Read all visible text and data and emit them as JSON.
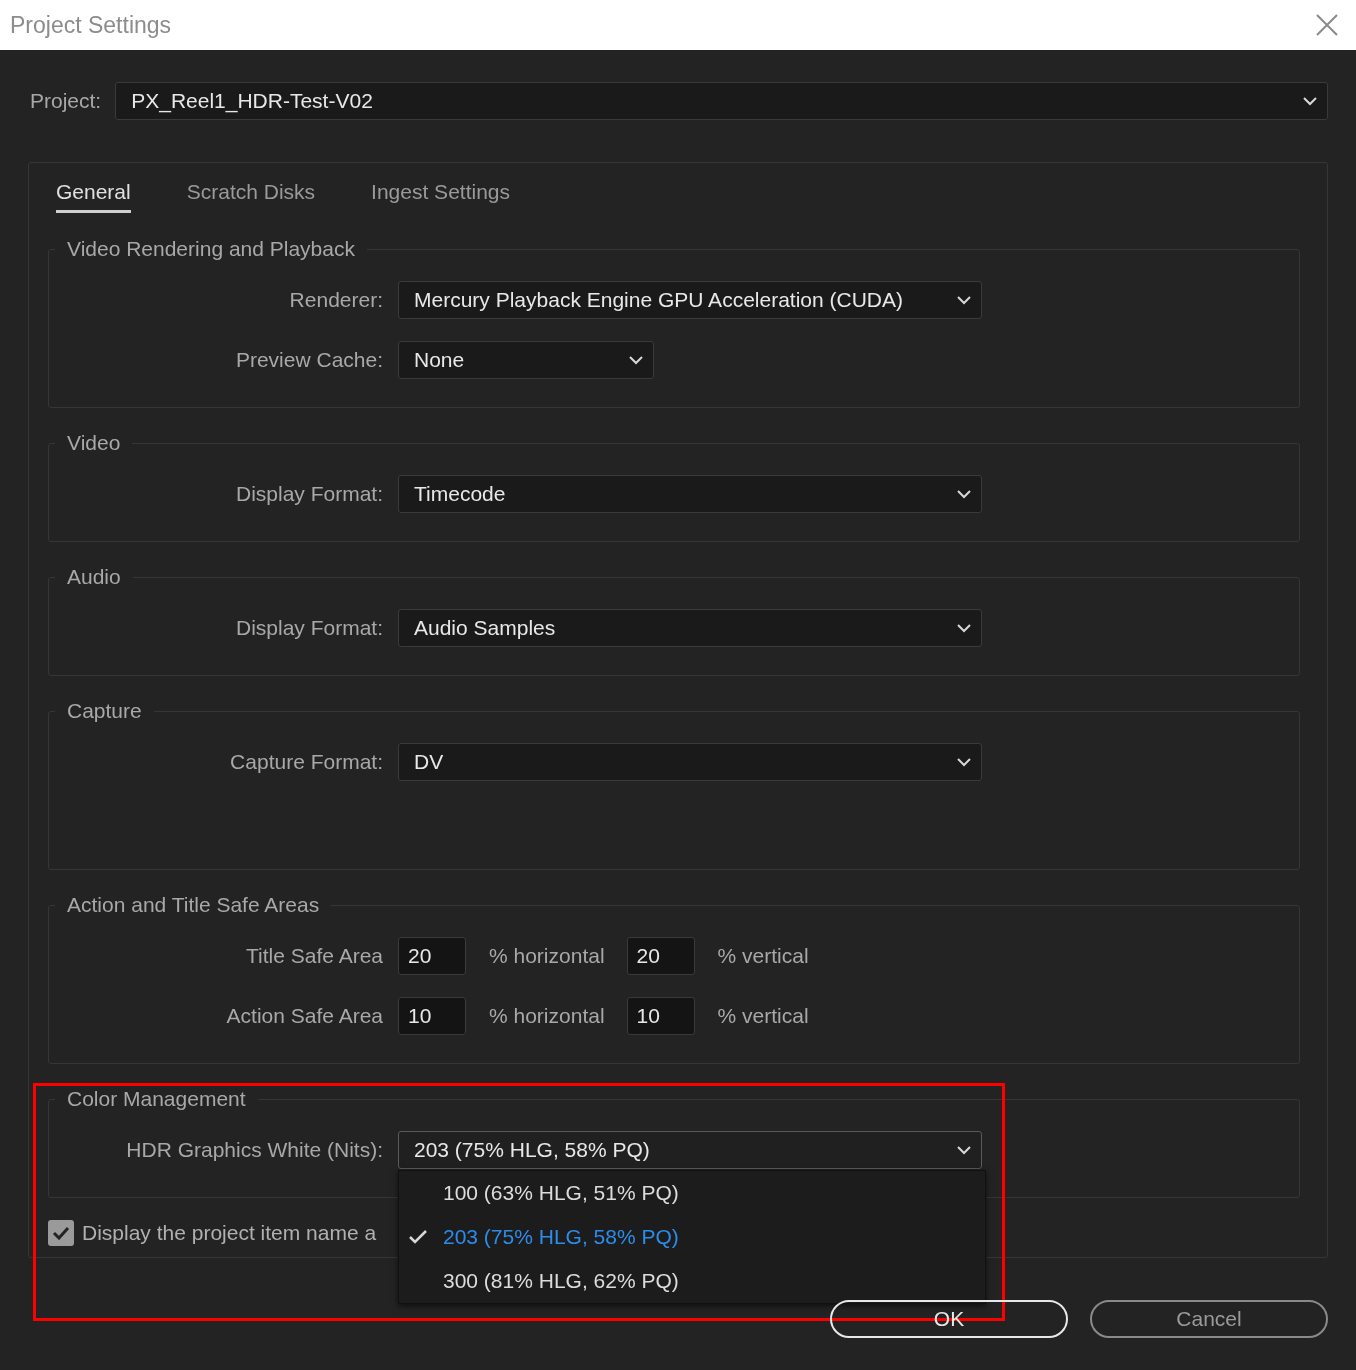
{
  "window": {
    "title": "Project Settings"
  },
  "project": {
    "label": "Project:",
    "value": "PX_Reel1_HDR-Test-V02"
  },
  "tabs": [
    {
      "label": "General",
      "selected": true
    },
    {
      "label": "Scratch Disks",
      "selected": false
    },
    {
      "label": "Ingest Settings",
      "selected": false
    }
  ],
  "sections": [
    {
      "title": "Video Rendering and Playback",
      "rows": [
        {
          "kind": "dropdown",
          "label": "Renderer:",
          "value": "Mercury Playback Engine GPU Acceleration (CUDA)"
        },
        {
          "kind": "dropdown",
          "label": "Preview Cache:",
          "value": "None"
        }
      ]
    },
    {
      "title": "Video",
      "rows": [
        {
          "kind": "dropdown",
          "label": "Display Format:",
          "value": "Timecode"
        }
      ]
    },
    {
      "title": "Audio",
      "rows": [
        {
          "kind": "dropdown",
          "label": "Display Format:",
          "value": "Audio Samples"
        }
      ]
    },
    {
      "title": "Capture",
      "rows": [
        {
          "kind": "dropdown",
          "label": "Capture Format:",
          "value": "DV"
        }
      ]
    },
    {
      "title": "Action and Title Safe Areas",
      "rows": [
        {
          "kind": "safe-area",
          "label": "Title Safe Area",
          "horizontal": "20",
          "horizontal_unit": "% horizontal",
          "vertical": "20",
          "vertical_unit": "% vertical"
        },
        {
          "kind": "safe-area",
          "label": "Action Safe Area",
          "horizontal": "10",
          "horizontal_unit": "% horizontal",
          "vertical": "10",
          "vertical_unit": "% vertical"
        }
      ]
    },
    {
      "title": "Color Management",
      "rows": [
        {
          "kind": "dropdown",
          "label": "HDR Graphics White (Nits):",
          "value": "203 (75% HLG, 58% PQ)",
          "expanded": true,
          "options": [
            {
              "label": "100 (63% HLG, 51% PQ)",
              "selected": false
            },
            {
              "label": "203 (75% HLG, 58% PQ)",
              "selected": true
            },
            {
              "label": "300 (81% HLG, 62% PQ)",
              "selected": false
            }
          ]
        }
      ]
    }
  ],
  "checkbox": {
    "label": "Display the project item name a",
    "checked": true
  },
  "buttons": [
    {
      "label": "OK",
      "kind": "default"
    },
    {
      "label": "Cancel",
      "kind": "normal"
    }
  ],
  "annotation": {
    "kind": "highlight-frame"
  }
}
